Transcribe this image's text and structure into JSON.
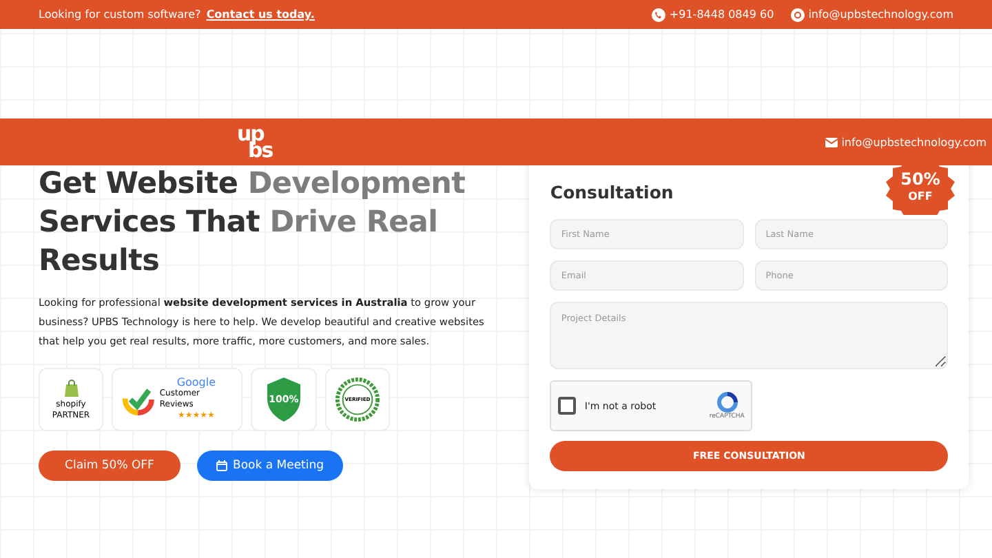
{
  "top_bar": {
    "prompt": "Looking for custom software?",
    "link": "Contact us today.",
    "phone": "+91-8448 0849 60",
    "email": "info@upbstechnology.com"
  },
  "header": {
    "logo_top": "up",
    "logo_bottom": "bs",
    "email": "info@upbstechnology.com"
  },
  "hero": {
    "heading_lines": [
      {
        "dark": "Get Website ",
        "light": "Development"
      },
      {
        "dark": "Services That ",
        "light": "Drive Real"
      },
      {
        "dark": "Results"
      }
    ],
    "intro": "Looking for professional **website development services in Australia** to grow your business? UPBS Technology is here to help. We develop beautiful and creative websites that help you get real results, more traffic, more customers, and more sales.",
    "badges": [
      {
        "kind": "shopify",
        "lines": [
          "shopify",
          "PARTNER"
        ]
      },
      {
        "kind": "google",
        "lines": [
          "Google",
          "Customer Reviews",
          "★★★★★"
        ]
      },
      {
        "kind": "secure",
        "lines": [
          "100%"
        ]
      },
      {
        "kind": "verified",
        "lines": [
          "VERIFIED"
        ]
      }
    ],
    "buttons": [
      {
        "kind": "primary",
        "label": "Claim 50% OFF"
      },
      {
        "kind": "meeting",
        "label": "Book a Meeting"
      }
    ]
  },
  "form": {
    "heading": "Consultation",
    "badge": [
      "50%",
      "OFF"
    ],
    "fields": [
      {
        "placeholder": "First Name",
        "kind": "half"
      },
      {
        "placeholder": "Last Name",
        "kind": "half"
      },
      {
        "placeholder": "Email",
        "kind": "half"
      },
      {
        "placeholder": "Phone",
        "kind": "half"
      },
      {
        "placeholder": "Project Details",
        "kind": "area"
      }
    ],
    "captcha": {
      "label": "I'm not a robot",
      "checked": false,
      "brand": "reCAPTCHA"
    },
    "submit": "FREE CONSULTATION"
  }
}
